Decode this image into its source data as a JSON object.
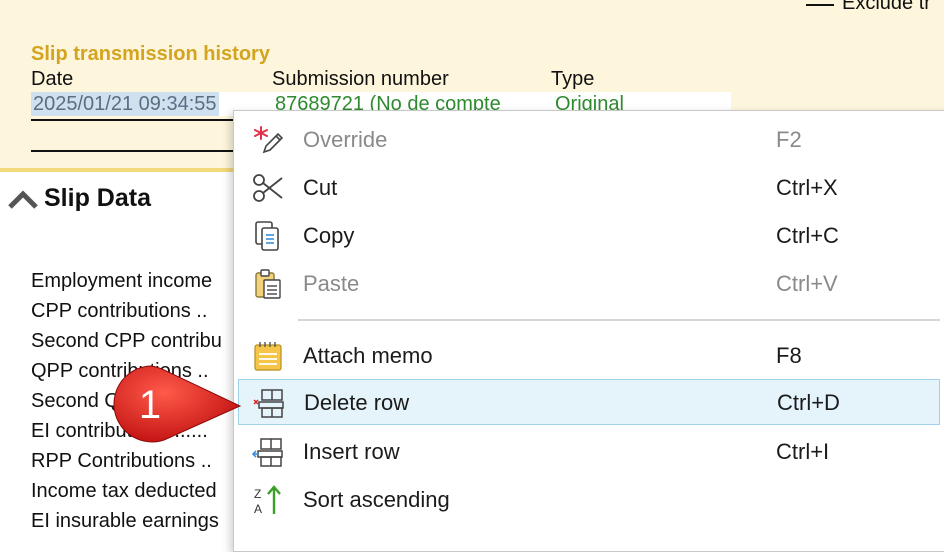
{
  "header": {
    "exclude_label": "Exclude tr"
  },
  "history": {
    "title": "Slip transmission history",
    "columns": [
      "Date",
      "Submission number",
      "Type"
    ],
    "row": {
      "date": "2025/01/21 09:34:55",
      "submission": "87689721 (No de compte",
      "type": "Original"
    }
  },
  "slip_data": {
    "title": "Slip Data",
    "labels": [
      "Employment income",
      "CPP contributions  ..",
      "Second CPP contribu",
      "QPP contributions  ..",
      "Second Q",
      "EI contributions  ......",
      "RPP Contributions  ..",
      "Income tax deducted",
      "EI insurable earnings"
    ]
  },
  "context_menu": {
    "items": [
      {
        "label": "Override",
        "shortcut": "F2",
        "icon": "override-icon",
        "enabled": false
      },
      {
        "label": "Cut",
        "shortcut": "Ctrl+X",
        "icon": "scissors-icon",
        "enabled": true
      },
      {
        "label": "Copy",
        "shortcut": "Ctrl+C",
        "icon": "copy-icon",
        "enabled": true
      },
      {
        "label": "Paste",
        "shortcut": "Ctrl+V",
        "icon": "clipboard-icon",
        "enabled": false
      },
      {
        "label": "Attach memo",
        "shortcut": "F8",
        "icon": "memo-icon",
        "enabled": true
      },
      {
        "label": "Delete row",
        "shortcut": "Ctrl+D",
        "icon": "delete-row-icon",
        "enabled": true,
        "hover": true
      },
      {
        "label": "Insert row",
        "shortcut": "Ctrl+I",
        "icon": "insert-row-icon",
        "enabled": true
      },
      {
        "label": "Sort ascending",
        "shortcut": "",
        "icon": "sort-ascending-icon",
        "enabled": true
      }
    ]
  },
  "callout": {
    "number": "1",
    "color": "#e02020"
  },
  "colors": {
    "accent_title": "#d4a421",
    "panel_bg": "#fdf6dc",
    "hover_bg": "#e5f3fb"
  }
}
